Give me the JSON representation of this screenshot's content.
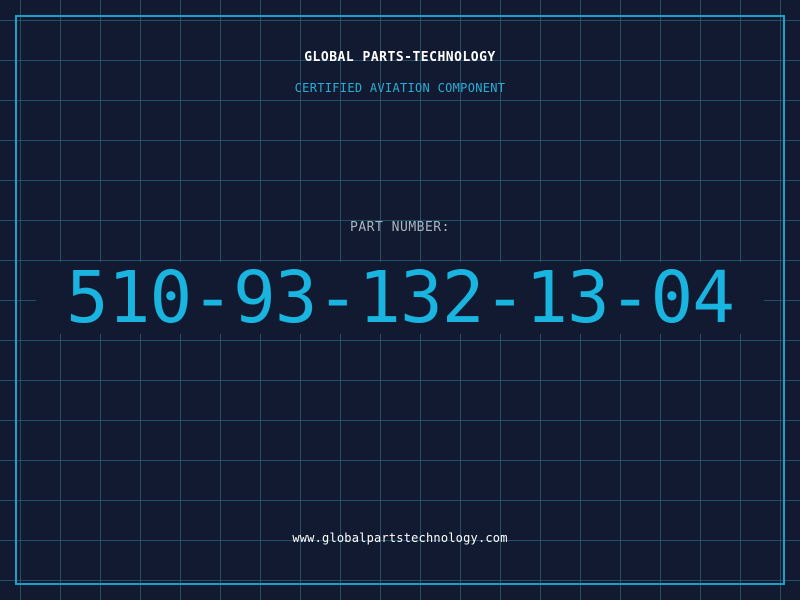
{
  "header": {
    "company_name": "GLOBAL PARTS-TECHNOLOGY",
    "tagline": "CERTIFIED AVIATION COMPONENT"
  },
  "part": {
    "label": "PART NUMBER:",
    "number": "510-93-132-13-04"
  },
  "footer": {
    "website": "www.globalpartstechnology.com"
  },
  "colors": {
    "background": "#111a30",
    "grid": "#30789a",
    "frame": "#1da0c8",
    "accent": "#19b4e0",
    "label": "#a9b4c2",
    "text": "#ffffff"
  }
}
